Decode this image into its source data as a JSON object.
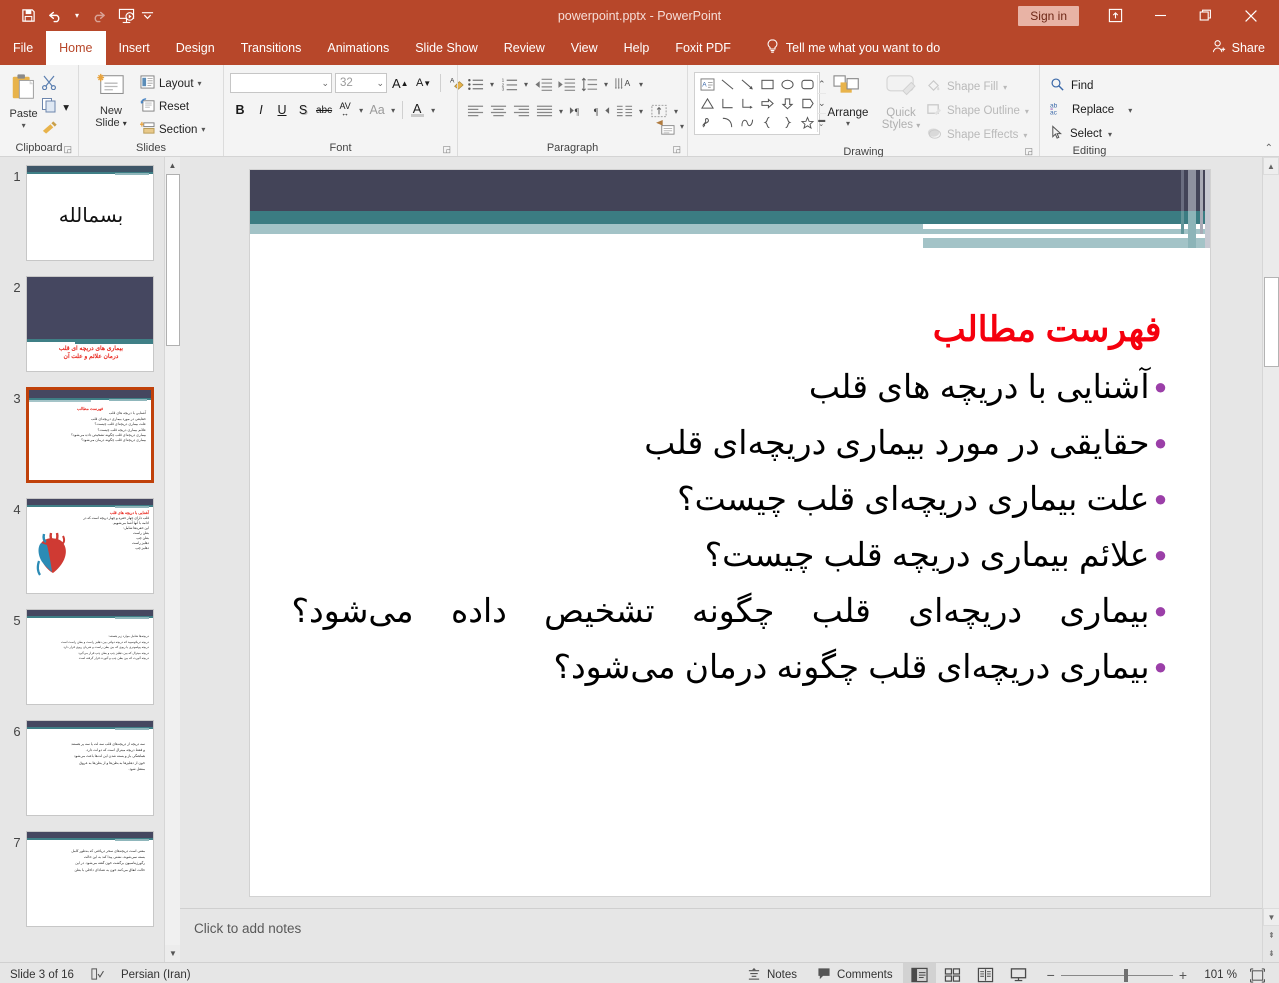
{
  "titlebar": {
    "document_title": "powerpoint.pptx  -  PowerPoint",
    "signin_label": "Sign in",
    "qat": [
      {
        "name": "save-icon",
        "label": "Save"
      },
      {
        "name": "undo-icon",
        "label": "Undo"
      },
      {
        "name": "redo-icon",
        "label": "Redo"
      },
      {
        "name": "start-presentation-icon",
        "label": "Start From Beginning"
      },
      {
        "name": "customize-qat-icon",
        "label": "Customize Quick Access Toolbar"
      }
    ],
    "window_buttons": {
      "ribbon_display": "Ribbon Display Options",
      "minimize": "—",
      "restore": "❐",
      "close": "✕"
    }
  },
  "menubar": {
    "items": [
      {
        "label": "File",
        "active": false
      },
      {
        "label": "Home",
        "active": true
      },
      {
        "label": "Insert",
        "active": false
      },
      {
        "label": "Design",
        "active": false
      },
      {
        "label": "Transitions",
        "active": false
      },
      {
        "label": "Animations",
        "active": false
      },
      {
        "label": "Slide Show",
        "active": false
      },
      {
        "label": "Review",
        "active": false
      },
      {
        "label": "View",
        "active": false
      },
      {
        "label": "Help",
        "active": false
      },
      {
        "label": "Foxit PDF",
        "active": false
      }
    ],
    "tellme": "Tell me what you want to do",
    "share": "Share"
  },
  "ribbon": {
    "clipboard": {
      "label": "Clipboard",
      "paste": "Paste",
      "cut": "Cut",
      "copy": "Copy",
      "format_painter": "Format Painter"
    },
    "slides": {
      "label": "Slides",
      "new_slide": "New\nSlide",
      "new_slide_line1": "New",
      "new_slide_line2": "Slide",
      "layout": "Layout",
      "reset": "Reset",
      "section": "Section"
    },
    "font": {
      "label": "Font",
      "font_name_value": "",
      "font_name_placeholder": "",
      "font_size_value": "32",
      "grow_font": "A",
      "shrink_font": "A",
      "clear_formatting": "Clear All Formatting",
      "bold": "B",
      "italic": "I",
      "underline": "U",
      "shadow": "S",
      "strikethrough": "abc",
      "character_spacing": "AV",
      "change_case": "Aa",
      "font_color": "A"
    },
    "paragraph": {
      "label": "Paragraph",
      "bullets": "Bullets",
      "numbering": "Numbering",
      "decrease_indent": "Decrease List Level",
      "increase_indent": "Increase List Level",
      "line_spacing": "Line Spacing",
      "align_left": "Align Left",
      "center": "Center",
      "align_right": "Align Right",
      "justify": "Justify",
      "ltr": "Left-to-Right",
      "rtl": "Right-to-Left",
      "columns": "Columns",
      "text_direction": "Text Direction",
      "align_text": "Align Text",
      "convert_smartart": "Convert to SmartArt"
    },
    "drawing": {
      "label": "Drawing",
      "arrange": "Arrange",
      "quick_styles_line1": "Quick",
      "quick_styles_line2": "Styles",
      "shape_fill": "Shape Fill",
      "shape_outline": "Shape Outline",
      "shape_effects": "Shape Effects",
      "shapes": [
        "textbox",
        "line",
        "arrow",
        "rectangle",
        "oval",
        "rounded-rectangle",
        "triangle",
        "elbow-connector",
        "elbow-arrow-connector",
        "right-arrow",
        "down-arrow",
        "pentagon-tag",
        "scribble",
        "arc",
        "curve",
        "left-brace",
        "right-brace",
        "star"
      ]
    },
    "editing": {
      "label": "Editing",
      "find": "Find",
      "replace": "Replace",
      "select": "Select"
    }
  },
  "thumbnails": [
    {
      "num": "1",
      "selected": false,
      "kind": "bismillah"
    },
    {
      "num": "2",
      "selected": false,
      "kind": "title",
      "line1": "بیماری های دریچه ای قلب",
      "line2": "درمان علائم و علت آن"
    },
    {
      "num": "3",
      "selected": true,
      "kind": "toc",
      "title": "فهرست مطالب",
      "lines": [
        "آشنایی با دریچه های قلب",
        "حقایقی در مورد بیماری دریچه‌ای قلب",
        "علت بیماری دریچه‌ای قلب چیست؟",
        "علائم بیماری دریچه قلب چیست؟",
        "بیماری دریچه‌ای قلب چگونه تشخیص داده می‌شود؟",
        "بیماری دریچه‌ای قلب چگونه درمان می‌شود؟"
      ]
    },
    {
      "num": "4",
      "selected": false,
      "kind": "heart",
      "title": "آشنایی با دریچه های قلب",
      "lines": [
        "قلب دارای چهار حفره و چهار دریچه است که در",
        "ادامه با آنها آشنا می‌شویم.",
        "این حفره‌ها شامل:",
        "بطن راست",
        "بطن چپ",
        "دهلیز راست",
        "دهلیز چپ"
      ]
    },
    {
      "num": "5",
      "selected": false,
      "kind": "text",
      "lines": [
        "دریچه‌ها شامل موارد زیر هستند:",
        "دریچه تریکوسپید که دریچه دولتی بین دهلیز راست و بطن راست است",
        "دریچه پولمونری یا ریوی که بین بطن راست و شریان ریوی قرار دارد",
        "دریچه میترال که بین دهلیز چپ و بطن چپ قرار می‌گیرد",
        "دریچه آئورت که بین بطن چپ و آئورت قرار گرفته است"
      ]
    },
    {
      "num": "6",
      "selected": false,
      "kind": "text",
      "lines": [
        "سه دریچه از دریچه‌های قلب سه لت یا سه پر هستند",
        "و فقط دریچه میترال است که دو لت دارد.",
        "هماهنگی باز و بسته شدن این لت‌ها باعث می‌شود",
        "خون از دهلیزها به بطن‌ها و از بطن‌ها به عروق",
        "منتقل شود."
      ]
    },
    {
      "num": "7",
      "selected": false,
      "kind": "text",
      "lines": [
        "معنی است دریچه‌های سحر دریافتی که به‌طور کامل",
        "بسته نمی‌شوند، نشتی پیدا کند به این حالت",
        "رگورژیتاسیون برگشت خون گفته می‌شود. در این",
        "حالت انقاق می‌کنند خون به تصادای داخلی با بطن"
      ]
    }
  ],
  "slide": {
    "title": "فهرست مطالب",
    "bullets": [
      {
        "text": "آشنایی با دریچه های قلب",
        "justify": false
      },
      {
        "text": "حقایقی در مورد بیماری دریچه‌ای قلب",
        "justify": false
      },
      {
        "text": "علت بیماری دریچه‌ای قلب چیست؟",
        "justify": false
      },
      {
        "text": "علائم بیماری دریچه قلب چیست؟",
        "justify": false
      },
      {
        "text": "بیماری دریچه‌ای قلب چگونه تشخیص داده می‌شود؟",
        "justify": true
      },
      {
        "text": "بیماری دریچه‌ای قلب چگونه درمان می‌شود؟",
        "justify": false
      }
    ],
    "colors": {
      "title_red": "#f5000d",
      "bullet_purple": "#9b3fa8",
      "band_dark": "#434458",
      "band_teal": "#3b7c82",
      "band_light": "#a3c3c7"
    }
  },
  "notes": {
    "placeholder": "Click to add notes"
  },
  "statusbar": {
    "slide_indicator": "Slide 3 of 16",
    "language": "Persian (Iran)",
    "spellcheck_icon": "spellcheck-icon",
    "notes_label": "Notes",
    "comments_label": "Comments",
    "views": [
      {
        "name": "normal-view",
        "active": true
      },
      {
        "name": "slide-sorter-view",
        "active": false
      },
      {
        "name": "reading-view",
        "active": false
      },
      {
        "name": "slide-show-view",
        "active": false
      }
    ],
    "zoom_out": "−",
    "zoom_in": "+",
    "zoom_percent": "101 %",
    "fit_slide": "Fit slide to current window"
  }
}
